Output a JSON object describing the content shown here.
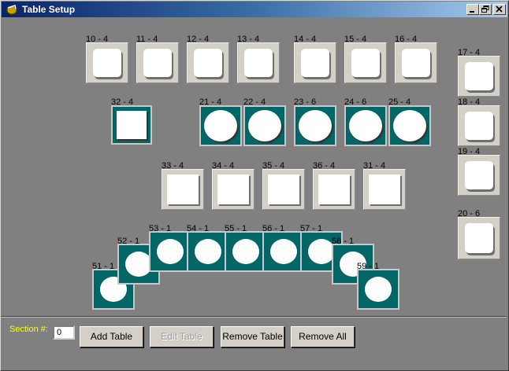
{
  "window": {
    "title": "Table Setup",
    "accent": "#0a246a"
  },
  "tables": {
    "t10": "10 - 4",
    "t11": "11 - 4",
    "t12": "12 - 4",
    "t13": "13 - 4",
    "t14": "14 - 4",
    "t15": "15 - 4",
    "t16": "16 - 4",
    "t17": "17 - 4",
    "t18": "18 - 4",
    "t19": "19 - 4",
    "t20": "20 - 6",
    "t32": "32 - 4",
    "t21": "21 - 4",
    "t22": "22 - 4",
    "t23": "23 - 6",
    "t24": "24 - 6",
    "t25": "25 - 4",
    "t33": "33 - 4",
    "t34": "34 - 4",
    "t35": "35 - 4",
    "t36": "36 - 4",
    "t31": "31 - 4",
    "t51": "51 - 1",
    "t52": "52 - 1",
    "t53": "53 - 1",
    "t54": "54 - 1",
    "t55": "55 - 1",
    "t56": "56 - 1",
    "t57": "57 - 1",
    "t58": "58 - 1",
    "t59": "59 - 1"
  },
  "colors": {
    "canvas": "#808080",
    "teal": "#006666",
    "section_label": "#ffff00"
  },
  "footer": {
    "section_label": "Section #:",
    "section_value": "0",
    "add_table": "Add Table",
    "edit_table": "Edit Table",
    "remove_table": "Remove Table",
    "remove_all": "Remove All"
  },
  "icons": {
    "app": "app-icon",
    "minimize": "minimize-icon",
    "restore": "restore-icon",
    "close": "close-icon"
  }
}
